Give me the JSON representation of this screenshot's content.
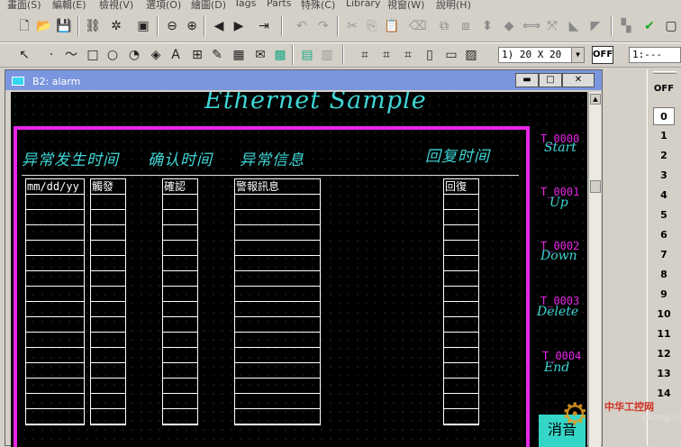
{
  "menu": [
    "畫面(S)",
    "編輯(E)",
    "檢視(V)",
    "選項(O)",
    "繪圖(D)",
    "Tags",
    "Parts",
    "特殊(C)",
    "Library",
    "視窗(W)",
    "說明(H)"
  ],
  "toolbar": {
    "grid_combo": "1) 20 X 20",
    "off_label": "OFF",
    "ratio_combo": "1:---"
  },
  "window": {
    "title": "B2: alarm",
    "heading": "Ethernet Sample",
    "column_headers": [
      "异常发生时间",
      "确认时间",
      "异常信息",
      "回复时间"
    ],
    "first_row": [
      "mm/dd/yy",
      "觸發",
      "確認",
      "警報訊息",
      "回復"
    ],
    "tags": [
      "T_0000",
      "T_0001",
      "T_0002",
      "T_0003",
      "T_0004"
    ],
    "buttons": [
      "Start",
      "Up",
      "Down",
      "Delete",
      "End"
    ],
    "mute_label": "消音"
  },
  "right_panel": {
    "off_label": "OFF",
    "numbers": [
      "0",
      "1",
      "2",
      "3",
      "4",
      "5",
      "6",
      "7",
      "8",
      "9",
      "10",
      "11",
      "12",
      "13",
      "14"
    ],
    "selected": "0"
  },
  "watermark": {
    "brand": "中华工控网",
    "url": "gkong.com"
  },
  "colors": {
    "accent_cyan": "#3fd6d6",
    "frame_magenta": "#e826e8",
    "titlebar": "#7a96df"
  }
}
